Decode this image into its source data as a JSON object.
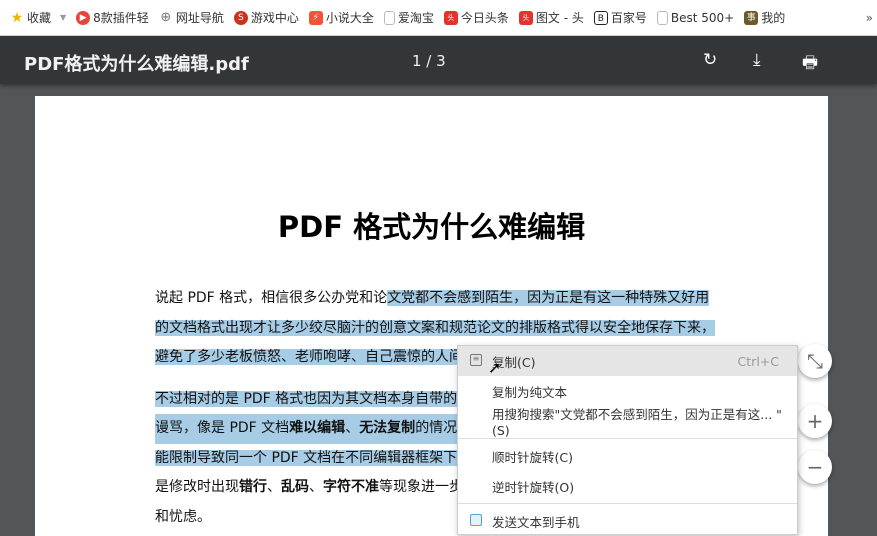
{
  "bookmarks": [
    {
      "label": "收藏",
      "icon": "star-icon",
      "color": "#f0b400"
    },
    {
      "label": "8款插件轻",
      "icon": "plugin-icon",
      "color": "#e8443a"
    },
    {
      "label": "网址导航",
      "icon": "globe-icon",
      "color": "#777777"
    },
    {
      "label": "游戏中心",
      "icon": "game-icon",
      "color": "#c9321f"
    },
    {
      "label": "小说大全",
      "icon": "novel-icon",
      "color": "#f0553a"
    },
    {
      "label": "爱淘宝",
      "icon": "page-icon",
      "color": "#bbbbbb"
    },
    {
      "label": "今日头条",
      "icon": "toutiao-icon",
      "color": "#e5322d"
    },
    {
      "label": "图文 - 头",
      "icon": "toutiao-icon",
      "color": "#e5322d"
    },
    {
      "label": "百家号",
      "icon": "baijiahao-icon",
      "color": "#222222"
    },
    {
      "label": "Best 500+",
      "icon": "page-icon",
      "color": "#bbbbbb"
    },
    {
      "label": "我的",
      "icon": "book-icon",
      "color": "#6b5a2a"
    }
  ],
  "toolbar": {
    "title": "PDF格式为什么难编辑.pdf",
    "page_indicator": "1 / 3"
  },
  "document": {
    "heading": "PDF 格式为什么难编辑",
    "p1": [
      "说起 PDF 格式，相信很多公办党和论",
      "文党都不会感到陌生，因为正是有这一种特殊又好用",
      "的文档格式出现才让多少绞尽脑汁的创意文案和规范论文的排版格式得以安全地保存下来，",
      "避免了多少老板愤怒、老师咆哮、自己震惊的人间悲剧。"
    ],
    "p2": [
      "不过相对的是 PDF 格式也因为其文档本身自带的",
      "谩骂，像是 PDF 文档",
      "难以编辑",
      "、",
      "无法复制",
      "的情况，",
      "能限制导致同一个 PDF 文档在不同编辑器框架下",
      "是修改时出现",
      "错行",
      "、",
      "乱码",
      "、",
      "字符不准",
      "等现象进一步",
      "和忧虑。"
    ]
  },
  "context_menu": {
    "copy": "复制(C)",
    "copy_shortcut": "Ctrl+C",
    "copy_plain": "复制为纯文本",
    "search": "用搜狗搜索\"文党都不会感到陌生，因为正是有这... \"(S)",
    "rotate_cw": "顺时针旋转(C)",
    "rotate_ccw": "逆时针旋转(O)",
    "send_phone": "发送文本到手机"
  }
}
